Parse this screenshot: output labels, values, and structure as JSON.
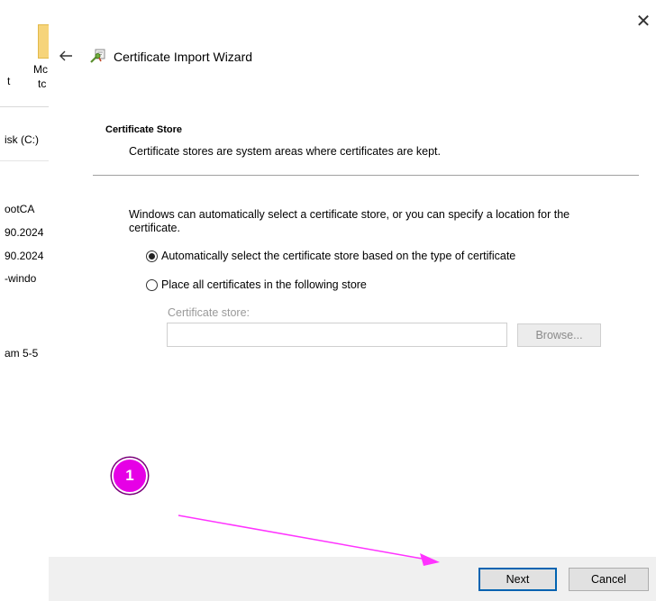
{
  "background_window": {
    "toolbar_fragment_1": "t",
    "toolbar_fragment_2": "Mc",
    "toolbar_fragment_3": "tc",
    "address_fragment": "isk (C:)",
    "file_rows": [
      "ootCA",
      "90.2024",
      "90.2024",
      "-windo",
      "am 5-5"
    ]
  },
  "wizard": {
    "title": "Certificate Import Wizard",
    "close_glyph": "✕",
    "section_heading": "Certificate Store",
    "section_subtitle": "Certificate stores are system areas where certificates are kept.",
    "description": "Windows can automatically select a certificate store, or you can specify a location for the certificate.",
    "radio_auto_label": "Automatically select the certificate store based on the type of certificate",
    "radio_auto_checked": true,
    "radio_place_label": "Place all certificates in the following store",
    "radio_place_checked": false,
    "store_label": "Certificate store:",
    "store_value": "",
    "browse_label": "Browse...",
    "next_label": "Next",
    "cancel_label": "Cancel"
  },
  "annotation": {
    "step_number": "1",
    "color": "#e600e6"
  },
  "icons": {
    "back": "back-arrow-icon",
    "wizard": "certificate-wizard-icon",
    "close": "close-icon"
  }
}
